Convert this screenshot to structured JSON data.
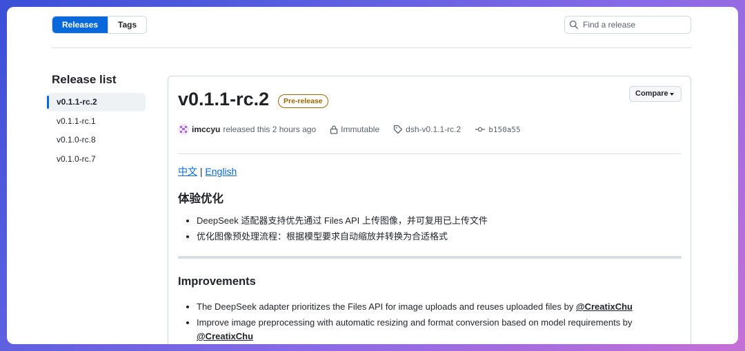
{
  "tabs": {
    "releases": "Releases",
    "tags": "Tags"
  },
  "search": {
    "placeholder": "Find a release"
  },
  "sidebar": {
    "title": "Release list",
    "items": [
      "v0.1.1-rc.2",
      "v0.1.1-rc.1",
      "v0.1.0-rc.8",
      "v0.1.0-rc.7"
    ]
  },
  "release": {
    "title": "v0.1.1-rc.2",
    "badge": "Pre-release",
    "compare": "Compare",
    "author": "imccyu",
    "released_text": "released this 2 hours ago",
    "immutable": "Immutable",
    "tag": "dsh-v0.1.1-rc.2",
    "commit": "b150a55"
  },
  "notes": {
    "lang_zh": "中文",
    "lang_sep": "|",
    "lang_en": "English",
    "zh_heading": "体验优化",
    "zh_items": [
      "DeepSeek 适配器支持优先通过 Files API 上传图像，并可复用已上传文件",
      "优化图像预处理流程：根据模型要求自动缩放并转换为合适格式"
    ],
    "en_heading": "Improvements",
    "en_items": [
      {
        "text": "The DeepSeek adapter prioritizes the Files API for image uploads and reuses uploaded files by ",
        "mention": "@CreatixChu"
      },
      {
        "text": "Improve image preprocessing with automatic resizing and format conversion based on model requirements by ",
        "mention": "@CreatixChu"
      }
    ]
  },
  "colors": {
    "accent": "#0969da",
    "prerelease": "#9a6700"
  }
}
